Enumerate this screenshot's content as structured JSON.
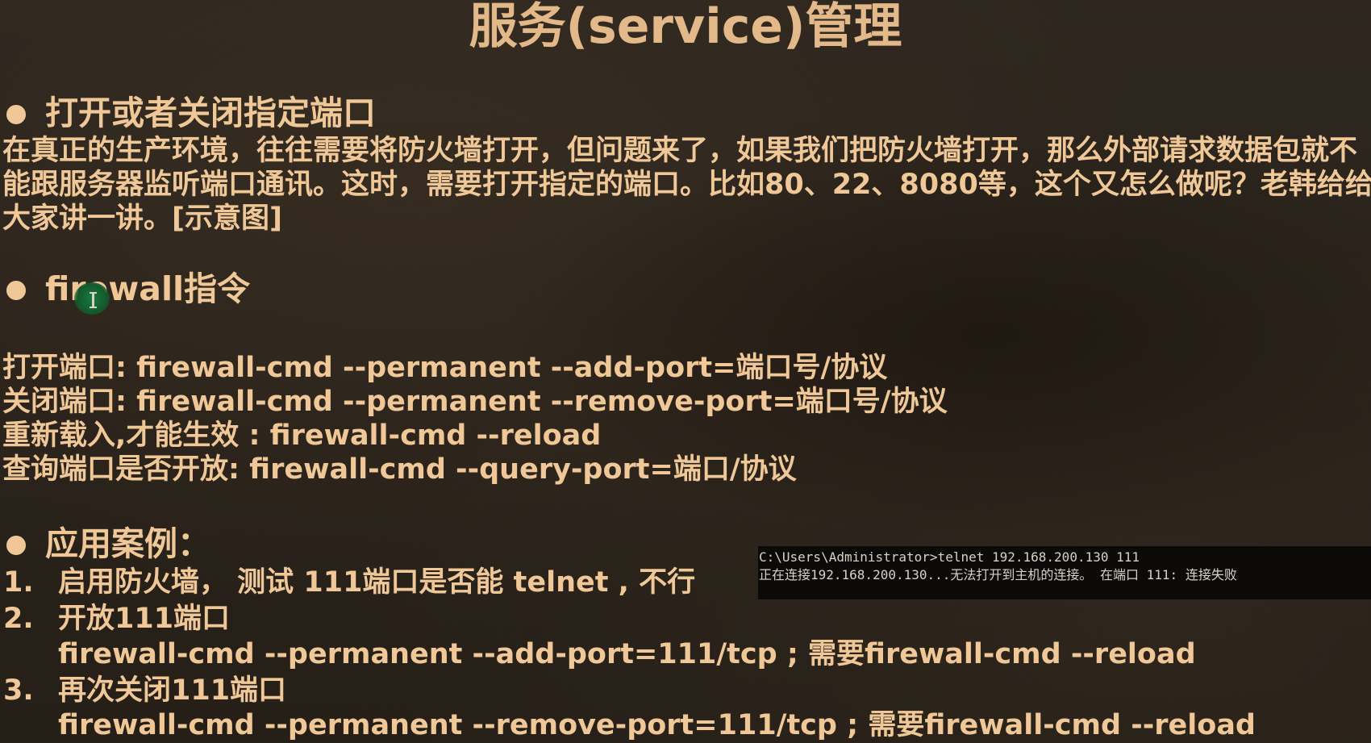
{
  "title": "服务(service)管理",
  "section1": {
    "heading": "打开或者关闭指定端口",
    "paragraph_lines": [
      "在真正的生产环境，往往需要将防火墙打开，但问题来了，如果我们把防火墙打开，那么外部请求数据包就不",
      "能跟服务器监听端口通讯。这时，需要打开指定的端口。比如80、22、8080等，这个又怎么做呢？老韩给给",
      "大家讲一讲。[示意图]"
    ]
  },
  "section2": {
    "heading": "firewall指令",
    "commands": [
      "打开端口:   firewall-cmd --permanent --add-port=端口号/协议",
      "关闭端口:   firewall-cmd --permanent --remove-port=端口号/协议",
      "重新载入,才能生效 : firewall-cmd --reload",
      "查询端口是否开放:  firewall-cmd --query-port=端口/协议"
    ]
  },
  "section3": {
    "heading": "应用案例：",
    "items": [
      {
        "num": "1.",
        "text": "启用防火墙， 测试 111端口是否能 telnet , 不行"
      },
      {
        "num": "2.",
        "text": "开放111端口"
      },
      {
        "num": "",
        "text": "firewall-cmd --permanent --add-port=111/tcp ; 需要firewall-cmd --reload"
      },
      {
        "num": "3.",
        "text": "再次关闭111端口"
      },
      {
        "num": "",
        "text": "firewall-cmd --permanent --remove-port=111/tcp ; 需要firewall-cmd --reload"
      }
    ]
  },
  "console": {
    "lines": [
      "C:\\Users\\Administrator>telnet 192.168.200.130 111",
      "正在连接192.168.200.130...无法打开到主机的连接。 在端口 111: 连接失败"
    ]
  },
  "colors": {
    "text": "#f0c898",
    "title": "#e3b98a",
    "background": "#2a231b",
    "console_bg": "#0b0a09",
    "cursor_highlight": "#1a7a3c"
  }
}
